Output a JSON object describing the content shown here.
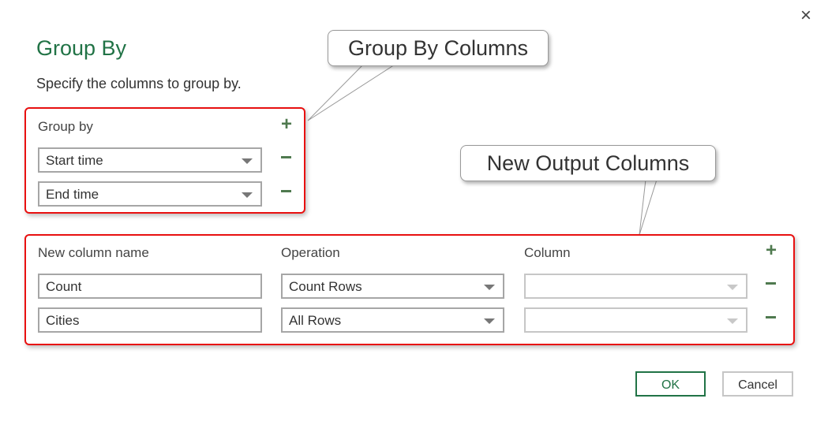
{
  "dialog": {
    "title": "Group By",
    "subtitle": "Specify the columns to group by."
  },
  "group_by": {
    "label": "Group by",
    "rows": [
      {
        "value": "Start time"
      },
      {
        "value": "End time"
      }
    ]
  },
  "aggregations": {
    "headers": {
      "name": "New column name",
      "operation": "Operation",
      "column": "Column"
    },
    "rows": [
      {
        "name": "Count",
        "operation": "Count Rows",
        "column": ""
      },
      {
        "name": "Cities",
        "operation": "All Rows",
        "column": ""
      }
    ]
  },
  "buttons": {
    "ok": "OK",
    "cancel": "Cancel"
  },
  "callouts": {
    "group_by": "Group By Columns",
    "output": "New Output Columns"
  },
  "icons": {
    "close": "×"
  },
  "colors": {
    "accent": "#217346",
    "highlight": "#e81010"
  }
}
